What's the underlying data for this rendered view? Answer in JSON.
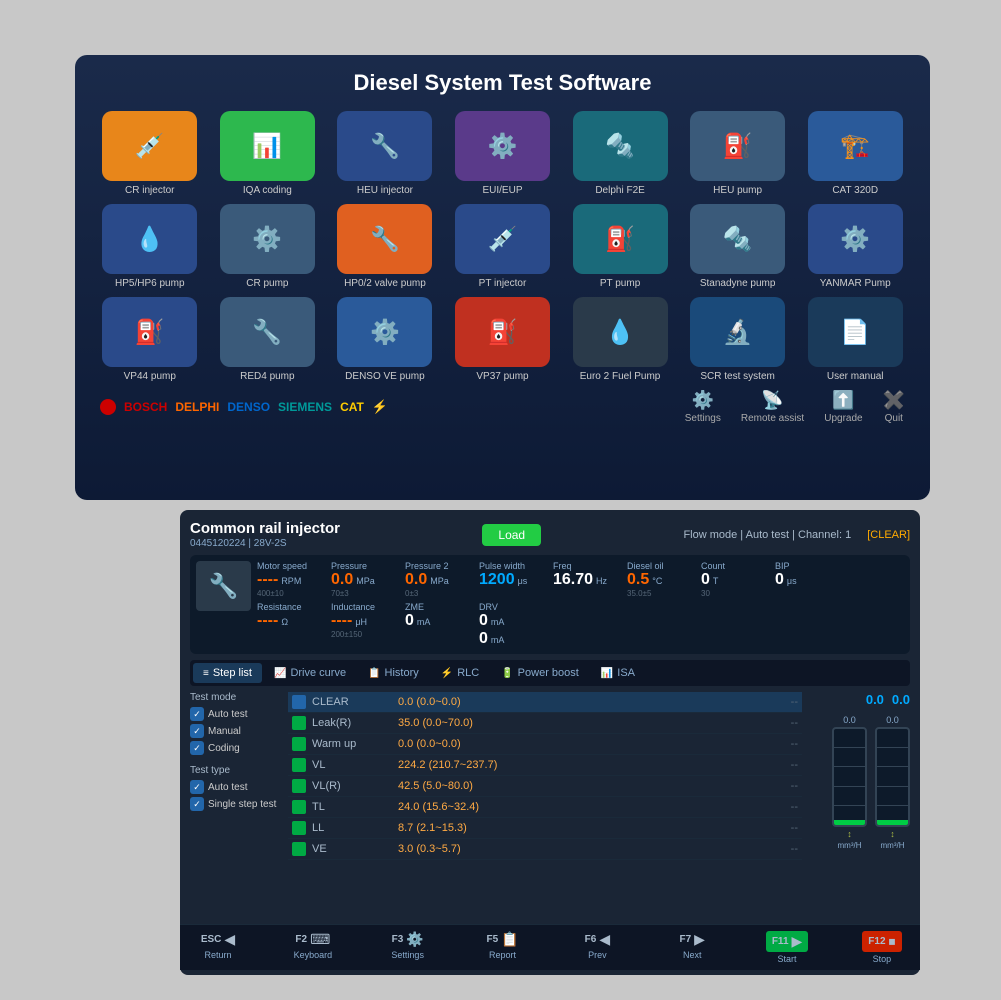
{
  "top": {
    "title": "Diesel System Test Software",
    "icons": [
      {
        "label": "CR injector",
        "bg": "bg-orange",
        "icon": "💉"
      },
      {
        "label": "IQA coding",
        "bg": "bg-green",
        "icon": "📊"
      },
      {
        "label": "HEU injector",
        "bg": "bg-blue-dark",
        "icon": "🔧"
      },
      {
        "label": "EUI/EUP",
        "bg": "bg-purple",
        "icon": "⚙️"
      },
      {
        "label": "Delphi F2E",
        "bg": "bg-teal",
        "icon": "🔩"
      },
      {
        "label": "HEU pump",
        "bg": "bg-gray-blue",
        "icon": "⛽"
      },
      {
        "label": "CAT 320D",
        "bg": "bg-blue-med",
        "icon": "🏗️"
      },
      {
        "label": "HP5/HP6 pump",
        "bg": "bg-blue-dark",
        "icon": "💧"
      },
      {
        "label": "CR pump",
        "bg": "bg-gray-blue",
        "icon": "⚙️"
      },
      {
        "label": "HP0/2 valve pump",
        "bg": "bg-orange2",
        "icon": "🔧"
      },
      {
        "label": "PT injector",
        "bg": "bg-blue-dark",
        "icon": "💉"
      },
      {
        "label": "PT pump",
        "bg": "bg-teal",
        "icon": "⛽"
      },
      {
        "label": "Stanadyne pump",
        "bg": "bg-gray-blue",
        "icon": "🔩"
      },
      {
        "label": "YANMAR Pump",
        "bg": "bg-blue-dark",
        "icon": "⚙️"
      },
      {
        "label": "VP44 pump",
        "bg": "bg-blue-dark",
        "icon": "⛽"
      },
      {
        "label": "RED4 pump",
        "bg": "bg-gray-blue",
        "icon": "🔧"
      },
      {
        "label": "DENSO VE pump",
        "bg": "bg-blue-med",
        "icon": "⚙️"
      },
      {
        "label": "VP37 pump",
        "bg": "bg-red",
        "icon": "⛽"
      },
      {
        "label": "Euro 2 Fuel Pump",
        "bg": "bg-dark-gray",
        "icon": "💧"
      },
      {
        "label": "SCR test system",
        "bg": "bg-blue-light",
        "icon": "🔬"
      },
      {
        "label": "User manual",
        "bg": "bg-pdf",
        "icon": "📄"
      }
    ],
    "brands": [
      "BOSCH",
      "DELPHI",
      "DENSO",
      "SIEMENS",
      "CAT"
    ],
    "actions": [
      {
        "label": "Settings",
        "icon": "⚙️"
      },
      {
        "label": "Remote assist",
        "icon": "📡"
      },
      {
        "label": "Upgrade",
        "icon": "⬆️"
      },
      {
        "label": "Quit",
        "icon": "✖️"
      }
    ]
  },
  "bottom": {
    "title": "Common rail injector",
    "subtitle": "0445120224 | 28V-2S",
    "load_btn": "Load",
    "mode_info": "Flow mode  |  Auto test  |  Channel: 1",
    "clear_btn": "[CLEAR]",
    "metrics": {
      "motor_speed": {
        "label": "Motor speed",
        "value": "----",
        "unit": "RPM",
        "range": "400±10"
      },
      "pressure": {
        "label": "Pressure",
        "value": "0.0",
        "unit": "MPa",
        "range": "70±3"
      },
      "pressure2": {
        "label": "Pressure 2",
        "value": "0.0",
        "unit": "MPa",
        "range": "0±3"
      },
      "pulse_width": {
        "label": "Pulse width",
        "value": "1200",
        "unit": "μs"
      },
      "freq": {
        "label": "Freq",
        "value": "16.70",
        "unit": "Hz"
      },
      "diesel_oil": {
        "label": "Diesel oil",
        "value": "0.5",
        "unit": "°C",
        "range": "35.0±5"
      },
      "count": {
        "label": "Count",
        "value": "0",
        "unit": "T",
        "range": "30"
      },
      "bip": {
        "label": "BIP",
        "value": "0",
        "unit": "μs"
      },
      "resistance": {
        "label": "Resistance",
        "value": "----",
        "unit": "Ω"
      },
      "inductance": {
        "label": "Inductance",
        "value": "----",
        "unit": "μH",
        "range": "200±150"
      },
      "zme": {
        "label": "ZME",
        "value": "0",
        "unit": "mA"
      },
      "drv": {
        "label": "DRV",
        "value": "0",
        "unit": "mA"
      },
      "drv2": {
        "label": "",
        "value": "0",
        "unit": "mA"
      }
    },
    "gauge_left": "0.0",
    "gauge_right": "0.0",
    "tabs": [
      {
        "label": "Step list",
        "icon": "≡",
        "active": true
      },
      {
        "label": "Drive curve",
        "icon": "📈",
        "active": false
      },
      {
        "label": "History",
        "icon": "📋",
        "active": false
      },
      {
        "label": "RLC",
        "icon": "⚡",
        "active": false
      },
      {
        "label": "Power boost",
        "icon": "🔋",
        "active": false
      },
      {
        "label": "ISA",
        "icon": "📊",
        "active": false
      }
    ],
    "test_mode": {
      "title": "Test mode",
      "items": [
        "Auto test",
        "Manual",
        "Coding"
      ]
    },
    "test_type": {
      "title": "Test type",
      "items": [
        "Auto test",
        "Single step test"
      ]
    },
    "steps": [
      {
        "name": "CLEAR",
        "value": "0.0 (0.0~0.0)",
        "extra": "--",
        "highlighted": true
      },
      {
        "name": "Leak(R)",
        "value": "35.0 (0.0~70.0)",
        "extra": "--"
      },
      {
        "name": "Warm up",
        "value": "0.0 (0.0~0.0)",
        "extra": "--"
      },
      {
        "name": "VL",
        "value": "224.2 (210.7~237.7)",
        "extra": "--"
      },
      {
        "name": "VL(R)",
        "value": "42.5 (5.0~80.0)",
        "extra": "--"
      },
      {
        "name": "TL",
        "value": "24.0 (15.6~32.4)",
        "extra": "--"
      },
      {
        "name": "LL",
        "value": "8.7 (2.1~15.3)",
        "extra": "--"
      },
      {
        "name": "VE",
        "value": "3.0 (0.3~5.7)",
        "extra": "--"
      }
    ],
    "func_keys": [
      {
        "f": "ESC",
        "icon": "◀",
        "label": "Return"
      },
      {
        "f": "F2",
        "icon": "⌨",
        "label": "Keyboard"
      },
      {
        "f": "F3",
        "icon": "⚙️",
        "label": "Settings"
      },
      {
        "f": "F5",
        "icon": "📋",
        "label": "Report"
      },
      {
        "f": "F6",
        "icon": "◀",
        "label": "Prev"
      },
      {
        "f": "F7",
        "icon": "▶",
        "label": "Next"
      },
      {
        "f": "F11",
        "icon": "▶",
        "label": "Start",
        "style": "start"
      },
      {
        "f": "F12",
        "icon": "⏹",
        "label": "Stop",
        "style": "stop"
      }
    ]
  }
}
